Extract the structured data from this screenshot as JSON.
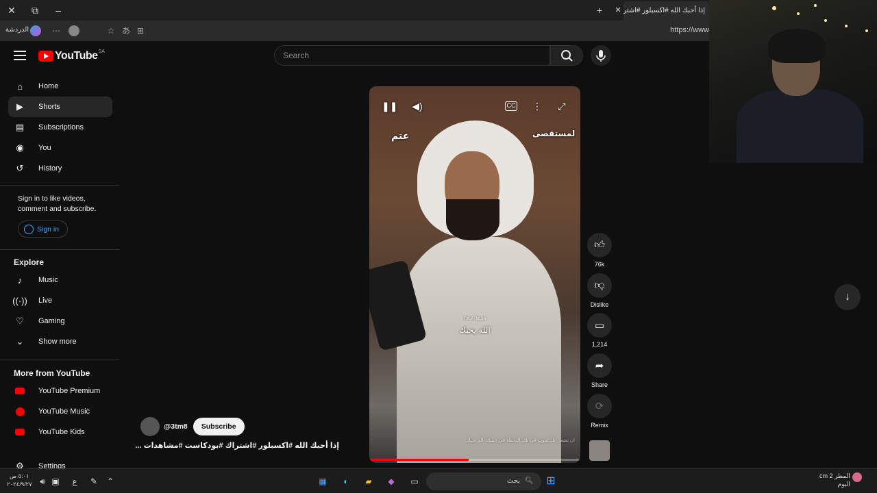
{
  "browser": {
    "tab_title": "إذا أحبك الله #اكسبلور #اشتراك",
    "url": "https://www",
    "chat_label": "الدردشة"
  },
  "header": {
    "logo_text": "YouTube",
    "region": "SA",
    "search_placeholder": "Search"
  },
  "sidebar": {
    "items": [
      {
        "label": "Home",
        "icon": "home-icon"
      },
      {
        "label": "Shorts",
        "icon": "shorts-icon",
        "selected": true
      },
      {
        "label": "Subscriptions",
        "icon": "subscriptions-icon"
      },
      {
        "label": "You",
        "icon": "you-icon"
      },
      {
        "label": "History",
        "icon": "history-icon"
      }
    ],
    "sign_in_prompt": "Sign in to like videos, comment and subscribe.",
    "sign_in_label": "Sign in",
    "explore_heading": "Explore",
    "explore": [
      {
        "label": "Music",
        "icon": "music-icon"
      },
      {
        "label": "Live",
        "icon": "live-icon"
      },
      {
        "label": "Gaming",
        "icon": "gaming-icon"
      },
      {
        "label": "Show more",
        "icon": "chevron-down-icon"
      }
    ],
    "more_heading": "More from YouTube",
    "more": [
      {
        "label": "YouTube Premium"
      },
      {
        "label": "YouTube Music"
      },
      {
        "label": "YouTube Kids"
      },
      {
        "label": "Settings"
      }
    ]
  },
  "video": {
    "overlay_logo_left": "عتم",
    "overlay_logo_right": "لمستقصى",
    "watermark": "TIK.ATM.SA",
    "caption": "الله يحبك",
    "bottom_text": "ان تشعر انك تموت في تلك اللحظة في حبيبك الله يحبك",
    "progress": 0.47
  },
  "actions": {
    "likes": "76k",
    "dislike": "Dislike",
    "comments": "1,214",
    "share": "Share",
    "remix": "Remix"
  },
  "channel": {
    "handle": "@3tm8",
    "subscribe": "Subscribe"
  },
  "video_title": "إذا أحبك الله #اكسبلور #اشتراك #بودكاست #مشاهدات ...",
  "taskbar": {
    "time": "٥:٠١ ص",
    "date": "٢٠٢٤/٩/٢٧",
    "lang": "ع",
    "search": "بحث",
    "weather_temp": "2 cm",
    "weather_label": "المطر",
    "weather_sub": "اليوم"
  }
}
